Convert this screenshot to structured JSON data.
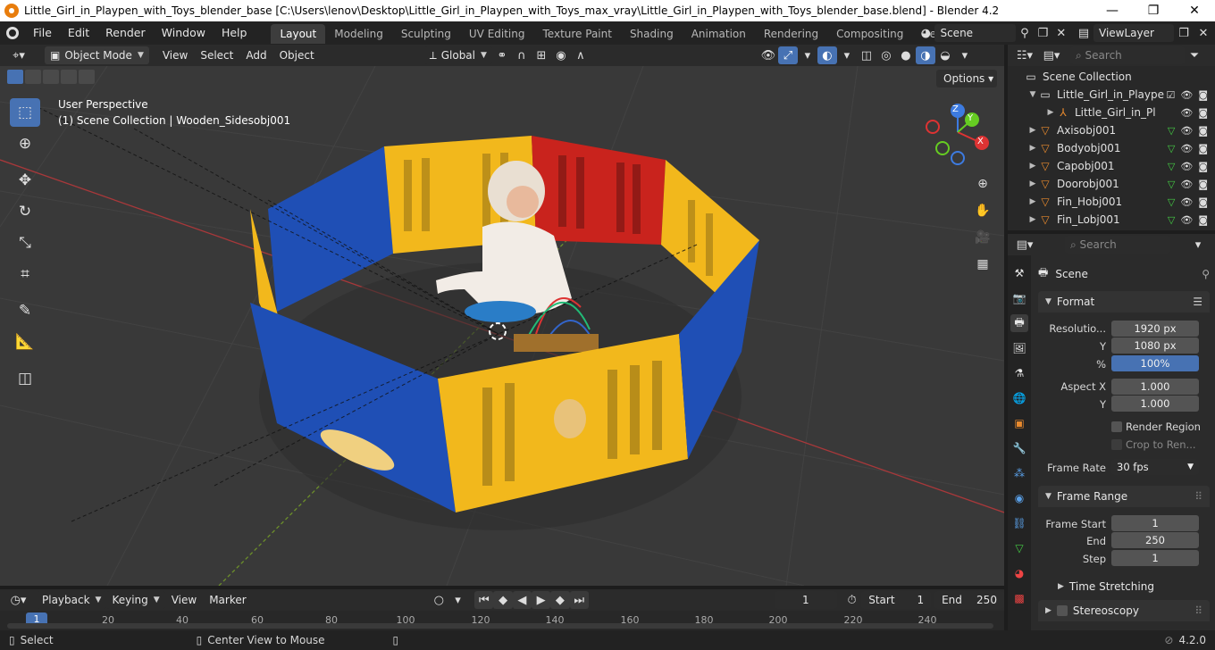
{
  "window": {
    "title": "Little_Girl_in_Playpen_with_Toys_blender_base [C:\\Users\\lenov\\Desktop\\Little_Girl_in_Playpen_with_Toys_max_vray\\Little_Girl_in_Playpen_with_Toys_blender_base.blend] - Blender 4.2",
    "minimize": "—",
    "maximize": "❐",
    "close": "✕"
  },
  "menu": [
    "File",
    "Edit",
    "Render",
    "Window",
    "Help"
  ],
  "workspaces": [
    "Layout",
    "Modeling",
    "Sculpting",
    "UV Editing",
    "Texture Paint",
    "Shading",
    "Animation",
    "Rendering",
    "Compositing",
    "Geometry Nod"
  ],
  "active_workspace": "Layout",
  "scene_selector": "Scene",
  "view_layer": "ViewLayer",
  "viewport_header": {
    "mode": "Object Mode",
    "menus": [
      "View",
      "Select",
      "Add",
      "Object"
    ],
    "orientation": "Global",
    "options": "Options"
  },
  "viewport": {
    "perspective": "User Perspective",
    "collection_info": "(1) Scene Collection | Wooden_Sidesobj001",
    "gizmo": {
      "x": "X",
      "y": "Y",
      "z": "Z"
    }
  },
  "outliner": {
    "search_placeholder": "Search",
    "root": "Scene Collection",
    "items": [
      {
        "label": "Little_Girl_in_Plaype",
        "type": "collection"
      },
      {
        "label": "Little_Girl_in_Pl",
        "type": "armature"
      },
      {
        "label": "Axisobj001",
        "type": "mesh"
      },
      {
        "label": "Bodyobj001",
        "type": "mesh"
      },
      {
        "label": "Capobj001",
        "type": "mesh"
      },
      {
        "label": "Doorobj001",
        "type": "mesh"
      },
      {
        "label": "Fin_Hobj001",
        "type": "mesh"
      },
      {
        "label": "Fin_Lobj001",
        "type": "mesh"
      }
    ]
  },
  "properties": {
    "search_placeholder": "Search",
    "context": "Scene",
    "format": {
      "title": "Format",
      "resolution_label": "Resolutio...",
      "res_x": "1920 px",
      "y_label": "Y",
      "res_y": "1080 px",
      "percent_label": "%",
      "percent": "100%",
      "aspect_x_label": "Aspect X",
      "aspect_x": "1.000",
      "aspect_y_label": "Y",
      "aspect_y": "1.000",
      "render_region": "Render Region",
      "crop": "Crop to Ren...",
      "frame_rate_label": "Frame Rate",
      "frame_rate": "30 fps"
    },
    "frame_range": {
      "title": "Frame Range",
      "start_label": "Frame Start",
      "start": "1",
      "end_label": "End",
      "end": "250",
      "step_label": "Step",
      "step": "1"
    },
    "time_stretching": "Time Stretching",
    "stereoscopy": "Stereoscopy"
  },
  "timeline": {
    "menus": [
      "Playback",
      "Keying",
      "View",
      "Marker"
    ],
    "current_frame": "1",
    "start_label": "Start",
    "start": "1",
    "end_label": "End",
    "end": "250",
    "ticks": [
      "1",
      "20",
      "40",
      "60",
      "80",
      "100",
      "120",
      "140",
      "160",
      "180",
      "200",
      "220",
      "240"
    ]
  },
  "statusbar": {
    "select": "Select",
    "center": "Center View to Mouse",
    "version": "4.2.0"
  },
  "colors": {
    "accent": "#4772b3",
    "panel_yellow": "#f2b81c",
    "panel_blue": "#1f4fb5",
    "panel_red": "#c9231d",
    "axis_red": "#a8383a",
    "axis_green": "#6c8f2a"
  }
}
